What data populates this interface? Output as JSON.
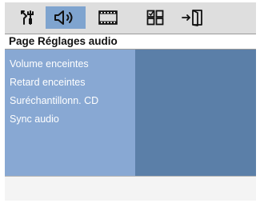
{
  "toolbar": {
    "icons": [
      {
        "name": "settings-tools-icon",
        "selected": false
      },
      {
        "name": "speaker-audio-icon",
        "selected": true
      },
      {
        "name": "video-film-icon",
        "selected": false
      },
      {
        "name": "preferences-grid-icon",
        "selected": false
      },
      {
        "name": "exit-door-icon",
        "selected": false
      }
    ]
  },
  "page": {
    "title": "Page Réglages audio"
  },
  "menu": {
    "items": [
      {
        "label": "Volume enceintes"
      },
      {
        "label": "Retard enceintes"
      },
      {
        "label": "Suréchantillonn. CD"
      },
      {
        "label": "Sync audio"
      }
    ]
  },
  "status": {
    "text": ""
  },
  "colors": {
    "selected_tab": "#7fa4cf",
    "menu_panel": "#88a8d3",
    "sub_panel": "#5b7fa8",
    "background": "#dcdcdc"
  }
}
